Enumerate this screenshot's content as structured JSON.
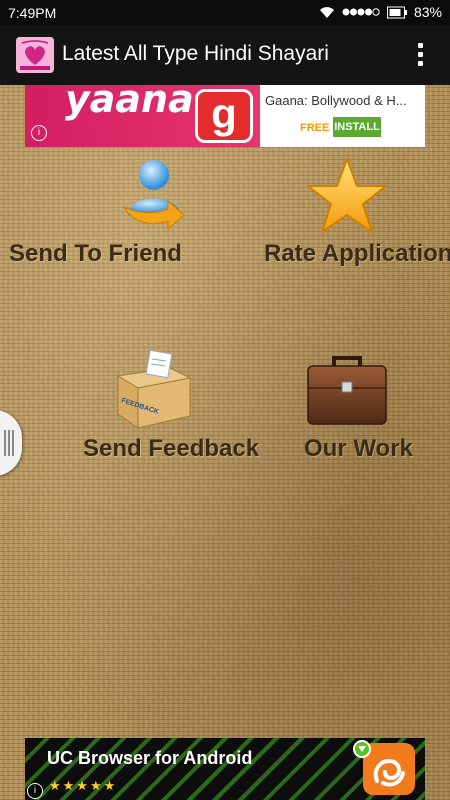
{
  "status_bar": {
    "time": "7:49PM",
    "battery": "83%",
    "icons": [
      "wifi-icon",
      "signal-icon",
      "battery-icon"
    ]
  },
  "app_bar": {
    "title": "Latest All Type Hindi Shayari",
    "logo_icon": "app-logo-icon",
    "menu_icon": "overflow-menu-icon"
  },
  "top_ad": {
    "banner_text": "yaana",
    "app_icon_glyph": "g",
    "title": "Gaana: Bollywood & H...",
    "free_label": "FREE",
    "install_label": "INSTALL",
    "info_glyph": "i"
  },
  "menu": {
    "send_to_friend": "Send To Friend",
    "rate_application": "Rate Application",
    "send_feedback": "Send Feedback",
    "our_work": "Our Work",
    "feedback_box_text": "FEEDBACK"
  },
  "bottom_ad": {
    "title": "UC Browser for Android",
    "stars": "★★★★★",
    "rating": 4.5,
    "info_glyph": "i"
  },
  "colors": {
    "app_bar": "#141414",
    "status_bar": "#0b0b0b",
    "background": "#b08f58",
    "label_text": "#3a2c18",
    "install_button": "#5ba832",
    "free_text": "#ee9b00",
    "gaana_banner": "#d11f62"
  }
}
